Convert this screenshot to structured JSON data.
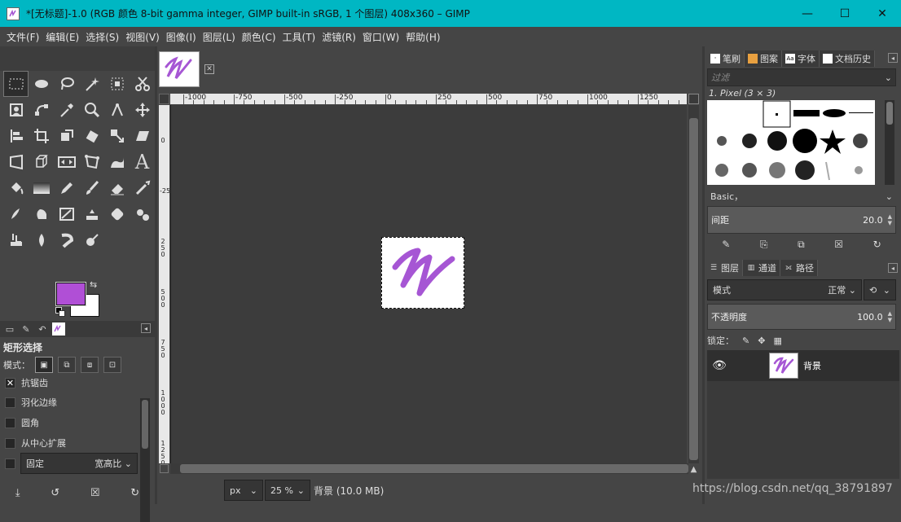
{
  "window": {
    "title": "*[无标题]-1.0 (RGB 颜色 8-bit gamma integer, GIMP built-in sRGB, 1 个图层) 408x360 – GIMP",
    "minimize": "—",
    "maximize": "☐",
    "close": "✕"
  },
  "menu": [
    "文件(F)",
    "编辑(E)",
    "选择(S)",
    "视图(V)",
    "图像(I)",
    "图层(L)",
    "颜色(C)",
    "工具(T)",
    "滤镜(R)",
    "窗口(W)",
    "帮助(H)"
  ],
  "colors": {
    "foreground": "#b04fd6",
    "background": "#ffffff",
    "titlebar": "#00b7c3",
    "stroke": "#a656d4"
  },
  "tool_options": {
    "title": "矩形选择",
    "mode_label": "模式：",
    "antialias": "抗锯齿",
    "feather": "羽化边缘",
    "rounded": "圆角",
    "expand_center": "从中心扩展",
    "fixed_label": "固定",
    "fixed_value": "宽高比"
  },
  "ruler": {
    "h_labels": [
      "-1000",
      "-750",
      "-500",
      "-250",
      "0",
      "250",
      "500",
      "750",
      "1000",
      "1250"
    ],
    "v_labels": [
      "0",
      "-250",
      "2 5 0",
      "5 0 0",
      "7 5 0",
      "1 0 0 0",
      "1 2 5 0"
    ]
  },
  "status": {
    "unit": "px",
    "zoom": "25 %",
    "info": "背景 (10.0 MB)"
  },
  "brushes_dock": {
    "tabs": [
      "笔刷",
      "图案",
      "字体",
      "文档历史"
    ],
    "filter_placeholder": "过滤",
    "brush_name": "1. Pixel (3 × 3)",
    "preset": "Basic，",
    "spacing_label": "间距",
    "spacing_value": "20.0"
  },
  "layers_dock": {
    "tabs": [
      "图层",
      "通道",
      "路径"
    ],
    "mode_label": "模式",
    "mode_value": "正常",
    "opacity_label": "不透明度",
    "opacity_value": "100.0",
    "lock_label": "锁定：",
    "layer_name": "背景"
  },
  "watermark": "https://blog.csdn.net/qq_38791897"
}
